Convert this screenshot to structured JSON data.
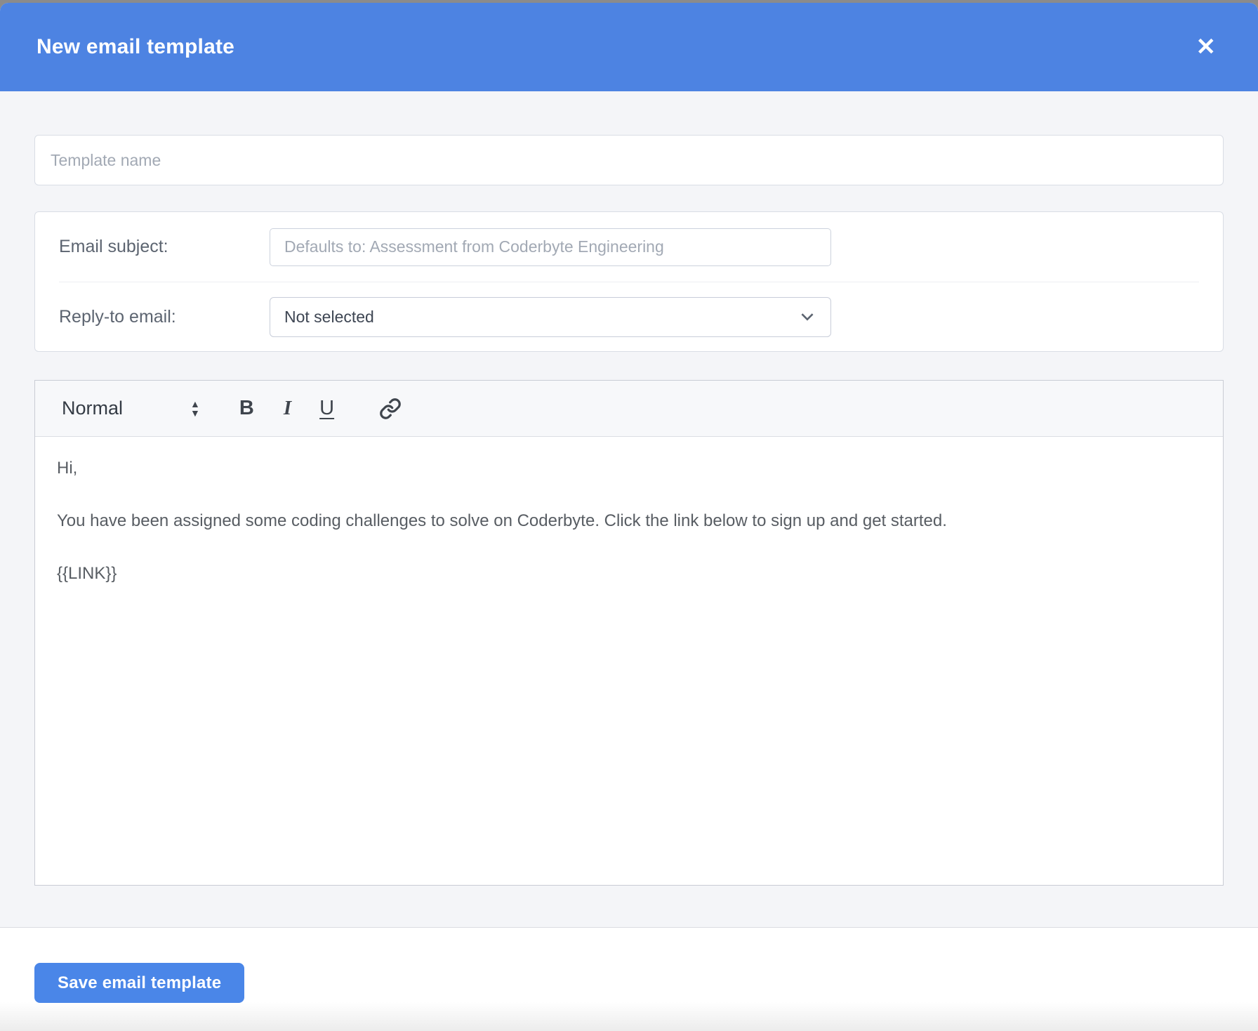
{
  "colors": {
    "header_blue": "#4d83e2",
    "save_button_blue": "#4a86e8",
    "page_background": "#f4f5f8"
  },
  "header": {
    "title": "New email template",
    "close_icon": "✕"
  },
  "template_name": {
    "placeholder": "Template name",
    "value": ""
  },
  "subject": {
    "label": "Email subject:",
    "placeholder": "Defaults to: Assessment from Coderbyte Engineering",
    "value": ""
  },
  "reply_to": {
    "label": "Reply-to email:",
    "selected_value": "Not selected"
  },
  "editor": {
    "toolbar": {
      "style_label": "Normal",
      "arrow_up": "▲",
      "arrow_down": "▼",
      "bold_label": "B",
      "italic_label": "I",
      "underline_label": "U"
    },
    "content": {
      "0": "Hi,",
      "1": "You have been assigned some coding challenges to solve on Coderbyte. Click the link below to sign up and get started.",
      "2": "{{LINK}}"
    }
  },
  "footer": {
    "save_label": "Save email template"
  }
}
